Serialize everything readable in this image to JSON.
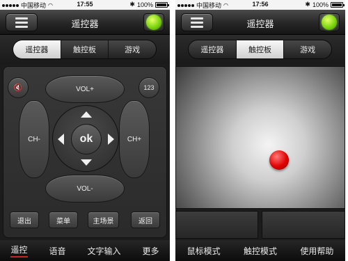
{
  "left": {
    "status": {
      "carrier": "中国移动",
      "time": "17:55",
      "battery": "100%"
    },
    "title": "遥控器",
    "tabs": [
      {
        "label": "遥控器",
        "active": true
      },
      {
        "label": "触控板",
        "active": false
      },
      {
        "label": "游戏",
        "active": false
      }
    ],
    "remote": {
      "vol_up": "VOL+",
      "vol_down": "VOL-",
      "ch_down": "CH-",
      "ch_up": "CH+",
      "ok": "ok",
      "num": "123",
      "mute_icon": "🔇",
      "buttons": [
        "退出",
        "菜单",
        "主场景",
        "返回"
      ]
    },
    "bottom": [
      "遥控",
      "语音",
      "文字输入",
      "更多"
    ]
  },
  "right": {
    "status": {
      "carrier": "中国移动",
      "time": "17:56",
      "battery": "100%"
    },
    "title": "遥控器",
    "tabs": [
      {
        "label": "遥控器",
        "active": false
      },
      {
        "label": "触控板",
        "active": true
      },
      {
        "label": "游戏",
        "active": false
      }
    ],
    "bottom": [
      "鼠标模式",
      "触控模式",
      "使用帮助"
    ]
  },
  "icons": {
    "menu": "menu-icon",
    "status_led": "green-status-icon",
    "touch_cursor": "red-cursor-icon"
  },
  "colors": {
    "led_green": "#7cd60f",
    "cursor_red": "#e00000",
    "active_tab": "#e6e6e6"
  }
}
